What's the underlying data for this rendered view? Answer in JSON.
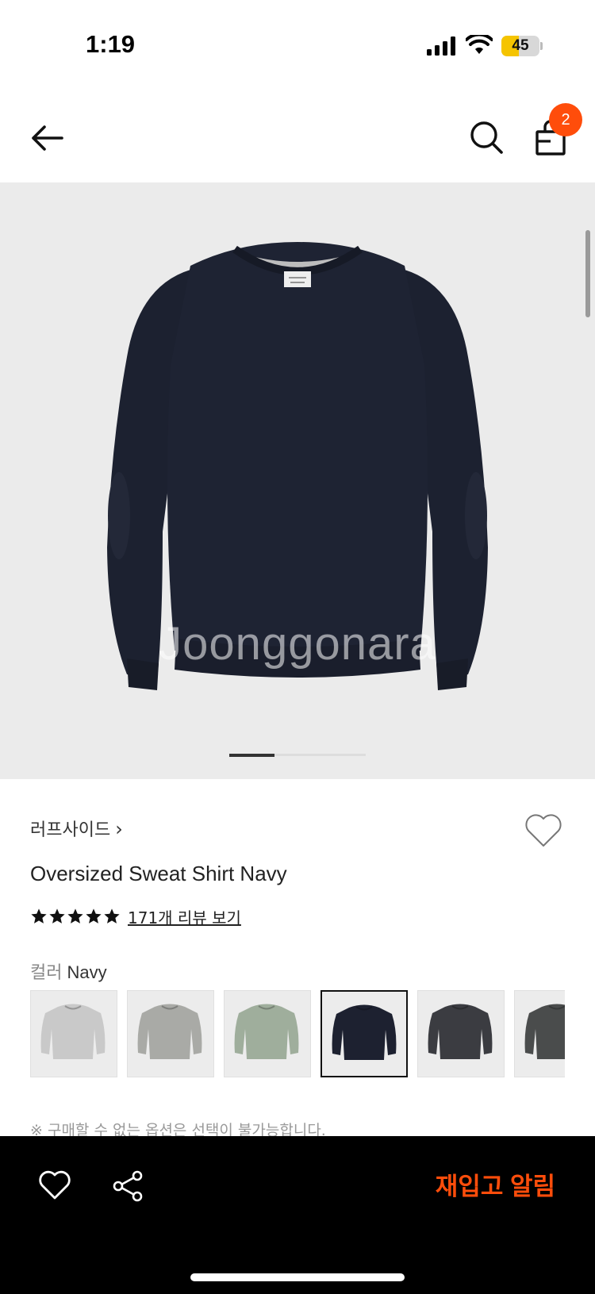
{
  "status_bar": {
    "time": "1:19",
    "battery_level": "45",
    "battery_fraction": 0.45
  },
  "header": {
    "back_icon": "arrow-left-icon",
    "search_icon": "search-icon",
    "cart_icon": "shopping-bag-icon",
    "cart_count": "2",
    "badge_color": "#ff4d0b"
  },
  "hero": {
    "watermark": "Joonggonara",
    "image_page": 1,
    "image_count": 3
  },
  "product": {
    "brand": "러프사이드",
    "brand_chevron": "›",
    "title": "Oversized Sweat Shirt Navy",
    "rating_stars": 5,
    "review_link": "171개 리뷰 보기",
    "color_label": "컬러",
    "color_value": "Navy",
    "swatches": [
      {
        "color": "#c9c9c9",
        "selected": false
      },
      {
        "color": "#a9aaa6",
        "selected": false
      },
      {
        "color": "#9fae9c",
        "selected": false
      },
      {
        "color": "#1d2130",
        "selected": true
      },
      {
        "color": "#3b3c41",
        "selected": false
      },
      {
        "color": "#4a4c4c",
        "selected": false
      }
    ],
    "notice": "※ 구매할 수 없는 옵션은 선택이 불가능합니다."
  },
  "bottom_bar": {
    "like_icon": "heart-outline-icon",
    "share_icon": "share-icon",
    "restock_label": "재입고 알림",
    "accent": "#ff4d0b"
  }
}
